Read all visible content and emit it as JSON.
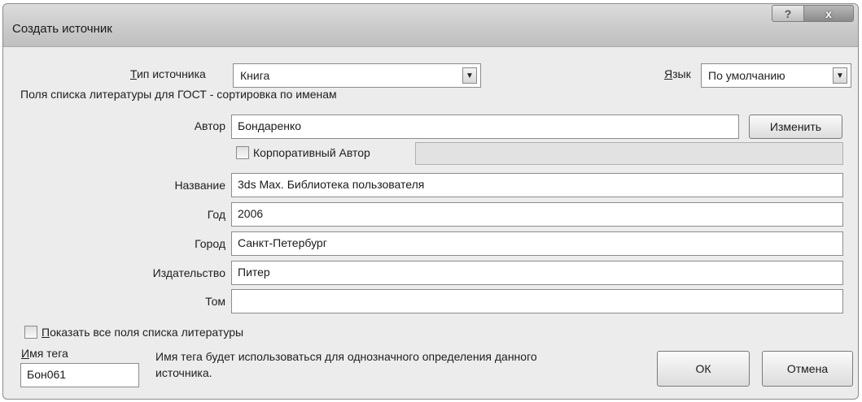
{
  "window": {
    "title": "Создать источник",
    "help_glyph": "?",
    "close_glyph": "x"
  },
  "source_type": {
    "label": "Тип источника",
    "value": "Книга"
  },
  "language": {
    "label": "Язык",
    "value": "По умолчанию"
  },
  "group_heading": "Поля списка литературы для ГОСТ - сортировка по именам",
  "author": {
    "label": "Автор",
    "value": "Бондаренко",
    "edit_button": "Изменить"
  },
  "corporate_author": {
    "label": "Корпоративный Автор",
    "checked": false,
    "value": ""
  },
  "fields": {
    "title": {
      "label": "Название",
      "value": "3ds Max. Библиотека пользователя"
    },
    "year": {
      "label": "Год",
      "value": "2006"
    },
    "city": {
      "label": "Город",
      "value": "Санкт-Петербург"
    },
    "publisher": {
      "label": "Издательство",
      "value": "Питер"
    },
    "volume": {
      "label": "Том",
      "value": ""
    }
  },
  "show_all": {
    "label": "Показать все поля списка литературы",
    "checked": false
  },
  "tag": {
    "label": "Имя тега",
    "value": "Бон061",
    "hint_line1": "Имя тега будет использоваться для однозначного определения данного",
    "hint_line2": "источника."
  },
  "buttons": {
    "ok": "ОК",
    "cancel": "Отмена"
  },
  "icons": {
    "dropdown": "chevron-down-icon",
    "help": "question-icon",
    "close": "close-icon"
  }
}
